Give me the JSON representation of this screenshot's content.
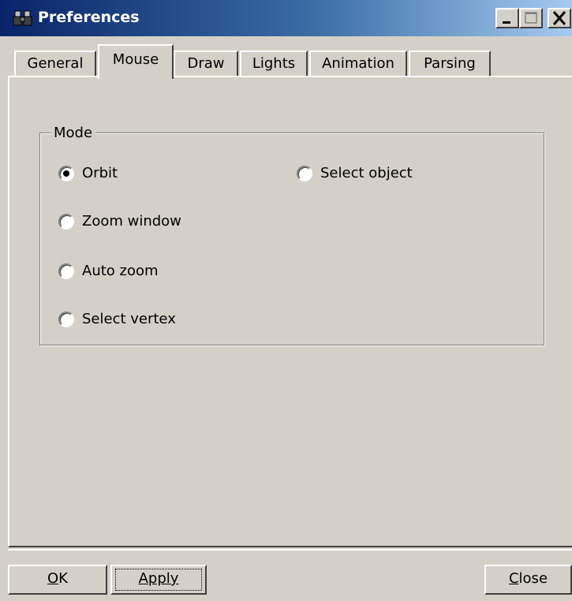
{
  "window": {
    "title": "Preferences"
  },
  "tabs": [
    {
      "label": "General",
      "active": false
    },
    {
      "label": "Mouse",
      "active": true
    },
    {
      "label": "Draw",
      "active": false
    },
    {
      "label": "Lights",
      "active": false
    },
    {
      "label": "Animation",
      "active": false
    },
    {
      "label": "Parsing",
      "active": false
    }
  ],
  "mode_group": {
    "label": "Mode",
    "options": [
      {
        "label": "Orbit",
        "selected": true
      },
      {
        "label": "Zoom window",
        "selected": false
      },
      {
        "label": "Auto zoom",
        "selected": false
      },
      {
        "label": "Select vertex",
        "selected": false
      },
      {
        "label": "Select object",
        "selected": false
      }
    ]
  },
  "buttons": {
    "ok": {
      "accel": "O",
      "rest": "K"
    },
    "apply": {
      "accel": "A",
      "rest": "pply"
    },
    "close": {
      "accel": "C",
      "rest": "lose"
    }
  },
  "icons": {
    "title": "binoculars-icon",
    "minimize": "minimize-icon",
    "maximize": "maximize-icon",
    "close": "close-icon"
  },
  "colors": {
    "titlebar_start": "#0a246a",
    "titlebar_end": "#a6caf0",
    "face": "#d4d0c8"
  }
}
